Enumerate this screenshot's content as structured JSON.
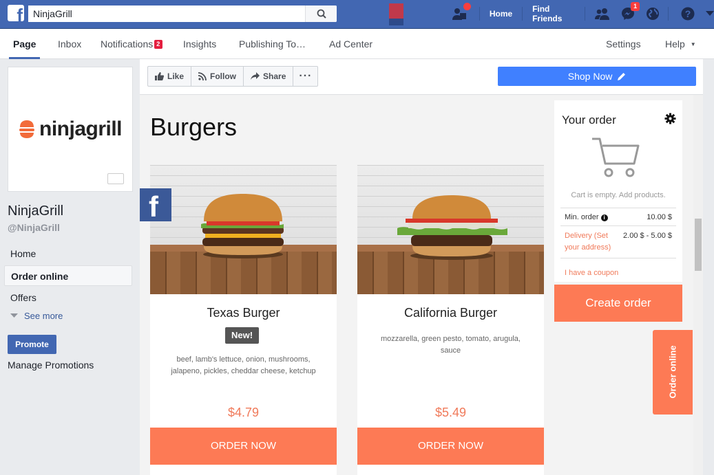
{
  "topbar": {
    "search_value": "NinjaGrill",
    "nav": {
      "home": "Home",
      "find_friends": "Find Friends"
    },
    "messenger_count": "1"
  },
  "page_tabs": [
    {
      "label": "Page"
    },
    {
      "label": "Inbox"
    },
    {
      "label": "Notifications",
      "badge": "2"
    },
    {
      "label": "Insights"
    },
    {
      "label": "Publishing To…"
    },
    {
      "label": "Ad Center"
    },
    {
      "label": "Settings"
    },
    {
      "label": "Help"
    }
  ],
  "profile": {
    "logo_text": "ninjagrill",
    "name": "NinjaGrill",
    "handle": "@NinjaGrill"
  },
  "left_nav": {
    "items": [
      {
        "label": "Home"
      },
      {
        "label": "Order online"
      },
      {
        "label": "Offers"
      }
    ],
    "see_more": "See more",
    "promote": "Promote",
    "manage_promotions": "Manage Promotions"
  },
  "actions": {
    "like": "Like",
    "follow": "Follow",
    "share": "Share",
    "shop_now": "Shop Now"
  },
  "menu": {
    "category_title": "Burgers",
    "items": [
      {
        "name": "Texas Burger",
        "badge": "New!",
        "description": "beef, lamb's lettuce, onion, mushrooms, jalapeno, pickles, cheddar cheese, ketchup",
        "price": "$4.79",
        "button": "ORDER NOW"
      },
      {
        "name": "California Burger",
        "description": "mozzarella, green pesto, tomato, arugula, sauce",
        "price": "$5.49",
        "button": "ORDER NOW"
      }
    ]
  },
  "order_panel": {
    "title": "Your order",
    "empty_text": "Cart is empty. Add products.",
    "min_order_label": "Min. order",
    "min_order_value": "10.00 $",
    "delivery_label": "Delivery (Set your address)",
    "delivery_value": "2.00 $ - 5.00 $",
    "coupon": "I have a coupon",
    "create_button": "Create order"
  },
  "side_tab": "Order online",
  "colors": {
    "fb_blue": "#4267b2",
    "accent": "#fd7a55",
    "link": "#365899"
  }
}
